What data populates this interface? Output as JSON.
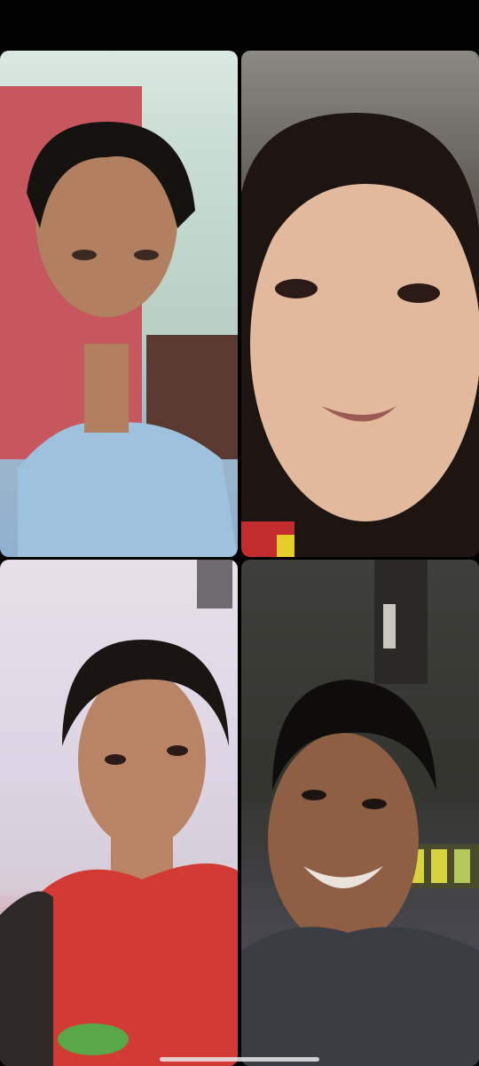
{
  "call": {
    "participants": [
      {
        "id": "p1",
        "video": "person-with-dark-hair-in-light-blue-shirt"
      },
      {
        "id": "p2",
        "video": "person-with-long-dark-hair"
      },
      {
        "id": "p3",
        "video": "person-in-red-shirt"
      },
      {
        "id": "p4",
        "video": "person-in-dark-gray-shirt"
      }
    ]
  },
  "colors": {
    "background": "#000000",
    "home_indicator": "#e9e9e9"
  }
}
